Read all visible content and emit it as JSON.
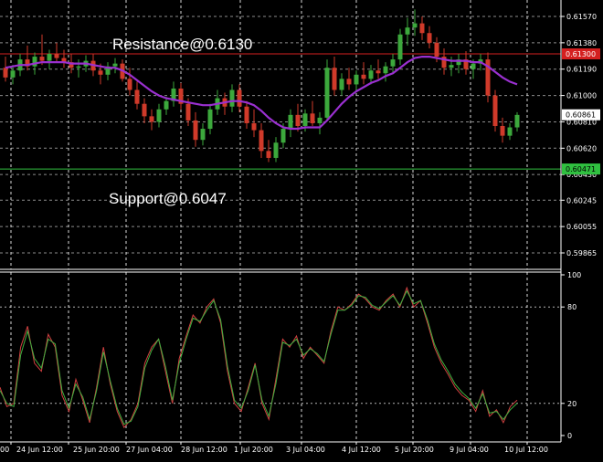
{
  "chart_data": [
    {
      "type": "candlestick",
      "title": "",
      "price_ticks": [
        "0.61570",
        "0.61380",
        "0.61190",
        "0.61000",
        "0.60810",
        "0.60620",
        "0.60430",
        "0.60245",
        "0.60055",
        "0.59865"
      ],
      "ylim": [
        0.5986,
        0.6163
      ],
      "current_price_label": "0.60861",
      "current_price": 0.60861,
      "resistance": {
        "value": 0.613,
        "label": "0.61300",
        "annotation": "Resistance@0.6130",
        "color": "#d42020"
      },
      "support": {
        "value": 0.6047,
        "label": "0.60471",
        "annotation": "Support@0.6047",
        "color": "#30c040"
      },
      "moving_average_color": "#9a30d0",
      "bull_color": "#3ca83c",
      "bear_color": "#d03a2a",
      "ohlc": [
        [
          0.612,
          0.6128,
          0.611,
          0.6113
        ],
        [
          0.6113,
          0.6122,
          0.6108,
          0.6118
        ],
        [
          0.6118,
          0.613,
          0.6114,
          0.6126
        ],
        [
          0.6126,
          0.6136,
          0.6118,
          0.6121
        ],
        [
          0.6121,
          0.6131,
          0.6115,
          0.6128
        ],
        [
          0.6128,
          0.6144,
          0.6122,
          0.6125
        ],
        [
          0.6125,
          0.6133,
          0.6119,
          0.613
        ],
        [
          0.613,
          0.6138,
          0.6124,
          0.6127
        ],
        [
          0.6127,
          0.6133,
          0.612,
          0.6124
        ],
        [
          0.6124,
          0.613,
          0.6116,
          0.612
        ],
        [
          0.612,
          0.6126,
          0.6113,
          0.6121
        ],
        [
          0.6121,
          0.6129,
          0.6117,
          0.6125
        ],
        [
          0.6125,
          0.613,
          0.6114,
          0.6118
        ],
        [
          0.6118,
          0.6123,
          0.6108,
          0.6115
        ],
        [
          0.6115,
          0.6124,
          0.6111,
          0.6121
        ],
        [
          0.6121,
          0.6127,
          0.6116,
          0.6123
        ],
        [
          0.6123,
          0.6126,
          0.611,
          0.6112
        ],
        [
          0.6112,
          0.612,
          0.61,
          0.6104
        ],
        [
          0.6104,
          0.611,
          0.609,
          0.6094
        ],
        [
          0.6094,
          0.6098,
          0.608,
          0.6085
        ],
        [
          0.6085,
          0.609,
          0.6075,
          0.6081
        ],
        [
          0.6081,
          0.6094,
          0.6077,
          0.609
        ],
        [
          0.609,
          0.6099,
          0.6086,
          0.6096
        ],
        [
          0.6096,
          0.611,
          0.6092,
          0.6105
        ],
        [
          0.6105,
          0.6109,
          0.609,
          0.6094
        ],
        [
          0.6094,
          0.6098,
          0.6078,
          0.6082
        ],
        [
          0.6082,
          0.6088,
          0.6063,
          0.6068
        ],
        [
          0.6068,
          0.608,
          0.6064,
          0.6076
        ],
        [
          0.6076,
          0.6094,
          0.6072,
          0.609
        ],
        [
          0.609,
          0.6104,
          0.6086,
          0.6098
        ],
        [
          0.6098,
          0.6102,
          0.6086,
          0.6092
        ],
        [
          0.6092,
          0.6108,
          0.6088,
          0.6104
        ],
        [
          0.6104,
          0.6108,
          0.6088,
          0.6092
        ],
        [
          0.6092,
          0.6096,
          0.6076,
          0.608
        ],
        [
          0.608,
          0.609,
          0.607,
          0.6075
        ],
        [
          0.6075,
          0.608,
          0.6055,
          0.606
        ],
        [
          0.606,
          0.6068,
          0.6052,
          0.6055
        ],
        [
          0.6055,
          0.607,
          0.6052,
          0.6066
        ],
        [
          0.6066,
          0.608,
          0.6062,
          0.6076
        ],
        [
          0.6076,
          0.609,
          0.607,
          0.6086
        ],
        [
          0.6086,
          0.6094,
          0.6074,
          0.6078
        ],
        [
          0.6078,
          0.609,
          0.6074,
          0.6087
        ],
        [
          0.6087,
          0.6096,
          0.6078,
          0.608
        ],
        [
          0.608,
          0.6088,
          0.6072,
          0.6084
        ],
        [
          0.6084,
          0.6126,
          0.6082,
          0.612
        ],
        [
          0.612,
          0.6128,
          0.61,
          0.6104
        ],
        [
          0.6104,
          0.6116,
          0.61,
          0.6112
        ],
        [
          0.6112,
          0.612,
          0.6104,
          0.6108
        ],
        [
          0.6108,
          0.6118,
          0.6104,
          0.6115
        ],
        [
          0.6115,
          0.6124,
          0.6108,
          0.6112
        ],
        [
          0.6112,
          0.6122,
          0.6108,
          0.6118
        ],
        [
          0.6118,
          0.6126,
          0.6112,
          0.6116
        ],
        [
          0.6116,
          0.6124,
          0.611,
          0.6121
        ],
        [
          0.6121,
          0.613,
          0.6116,
          0.6126
        ],
        [
          0.6126,
          0.6148,
          0.6122,
          0.6144
        ],
        [
          0.6144,
          0.6156,
          0.6136,
          0.6149
        ],
        [
          0.6149,
          0.6162,
          0.6143,
          0.6152
        ],
        [
          0.6152,
          0.6157,
          0.614,
          0.6145
        ],
        [
          0.6145,
          0.615,
          0.6134,
          0.6138
        ],
        [
          0.6138,
          0.6142,
          0.6124,
          0.6128
        ],
        [
          0.6128,
          0.6134,
          0.6115,
          0.612
        ],
        [
          0.612,
          0.6128,
          0.6114,
          0.6122
        ],
        [
          0.6122,
          0.613,
          0.6116,
          0.6126
        ],
        [
          0.6126,
          0.6132,
          0.6115,
          0.6119
        ],
        [
          0.6119,
          0.6126,
          0.6112,
          0.6123
        ],
        [
          0.6123,
          0.613,
          0.6118,
          0.6126
        ],
        [
          0.6126,
          0.6131,
          0.6095,
          0.61
        ],
        [
          0.61,
          0.6104,
          0.6074,
          0.6078
        ],
        [
          0.6078,
          0.6084,
          0.6066,
          0.6071
        ],
        [
          0.6071,
          0.608,
          0.6068,
          0.6077
        ],
        [
          0.6077,
          0.6088,
          0.6074,
          0.6086
        ]
      ],
      "ma": [
        0.612,
        0.6121,
        0.6122,
        0.6122,
        0.6123,
        0.6124,
        0.6124,
        0.6124,
        0.6124,
        0.6123,
        0.6123,
        0.6123,
        0.6122,
        0.6121,
        0.612,
        0.612,
        0.6118,
        0.6115,
        0.6111,
        0.6107,
        0.6103,
        0.61,
        0.6098,
        0.6097,
        0.6096,
        0.6095,
        0.6094,
        0.6093,
        0.6093,
        0.6094,
        0.6095,
        0.6096,
        0.6096,
        0.6095,
        0.6093,
        0.6089,
        0.6084,
        0.608,
        0.6077,
        0.6076,
        0.6076,
        0.6077,
        0.6077,
        0.6077,
        0.6082,
        0.6088,
        0.6094,
        0.6099,
        0.6103,
        0.6106,
        0.6109,
        0.6111,
        0.6114,
        0.6116,
        0.612,
        0.6124,
        0.6127,
        0.6128,
        0.6128,
        0.6127,
        0.6126,
        0.6125,
        0.6125,
        0.6125,
        0.6124,
        0.6124,
        0.6121,
        0.6117,
        0.6113,
        0.611,
        0.6108
      ],
      "x_tick_labels": [
        "00",
        "24 Jun 12:00",
        "25 Jun 20:00",
        "27 Jun 04:00",
        "28 Jun 12:00",
        "1 Jul 20:00",
        "3 Jul 04:00",
        "4 Jul 12:00",
        "5 Jul 20:00",
        "9 Jul 04:00",
        "10 Jul 12:00"
      ]
    },
    {
      "type": "line",
      "title": "",
      "oscillator_ticks": [
        "100",
        "80",
        "20",
        "0"
      ],
      "ylim": [
        0,
        100
      ],
      "levels": [
        80,
        20
      ],
      "series": [
        {
          "color": "#d04040",
          "values": [
            30,
            18,
            20,
            55,
            68,
            45,
            40,
            63,
            55,
            25,
            15,
            35,
            22,
            8,
            30,
            55,
            32,
            15,
            5,
            10,
            20,
            45,
            55,
            60,
            40,
            20,
            48,
            62,
            75,
            70,
            80,
            85,
            70,
            40,
            20,
            15,
            30,
            45,
            20,
            10,
            35,
            60,
            55,
            62,
            48,
            55,
            50,
            45,
            65,
            80,
            78,
            82,
            88,
            85,
            80,
            78,
            84,
            88,
            80,
            92,
            80,
            84,
            70,
            55,
            45,
            38,
            30,
            25,
            22,
            15,
            28,
            12,
            16,
            8,
            18,
            22
          ]
        },
        {
          "color": "#40b040",
          "values": [
            28,
            20,
            18,
            50,
            65,
            48,
            42,
            60,
            57,
            28,
            17,
            32,
            24,
            10,
            28,
            52,
            34,
            17,
            7,
            9,
            18,
            42,
            53,
            60,
            43,
            22,
            45,
            60,
            73,
            71,
            78,
            84,
            72,
            43,
            22,
            17,
            28,
            44,
            22,
            12,
            32,
            58,
            56,
            60,
            50,
            54,
            51,
            46,
            63,
            78,
            78,
            81,
            87,
            86,
            81,
            79,
            83,
            87,
            81,
            90,
            82,
            84,
            72,
            57,
            47,
            40,
            32,
            27,
            23,
            17,
            26,
            14,
            15,
            10,
            16,
            20
          ]
        }
      ]
    }
  ]
}
